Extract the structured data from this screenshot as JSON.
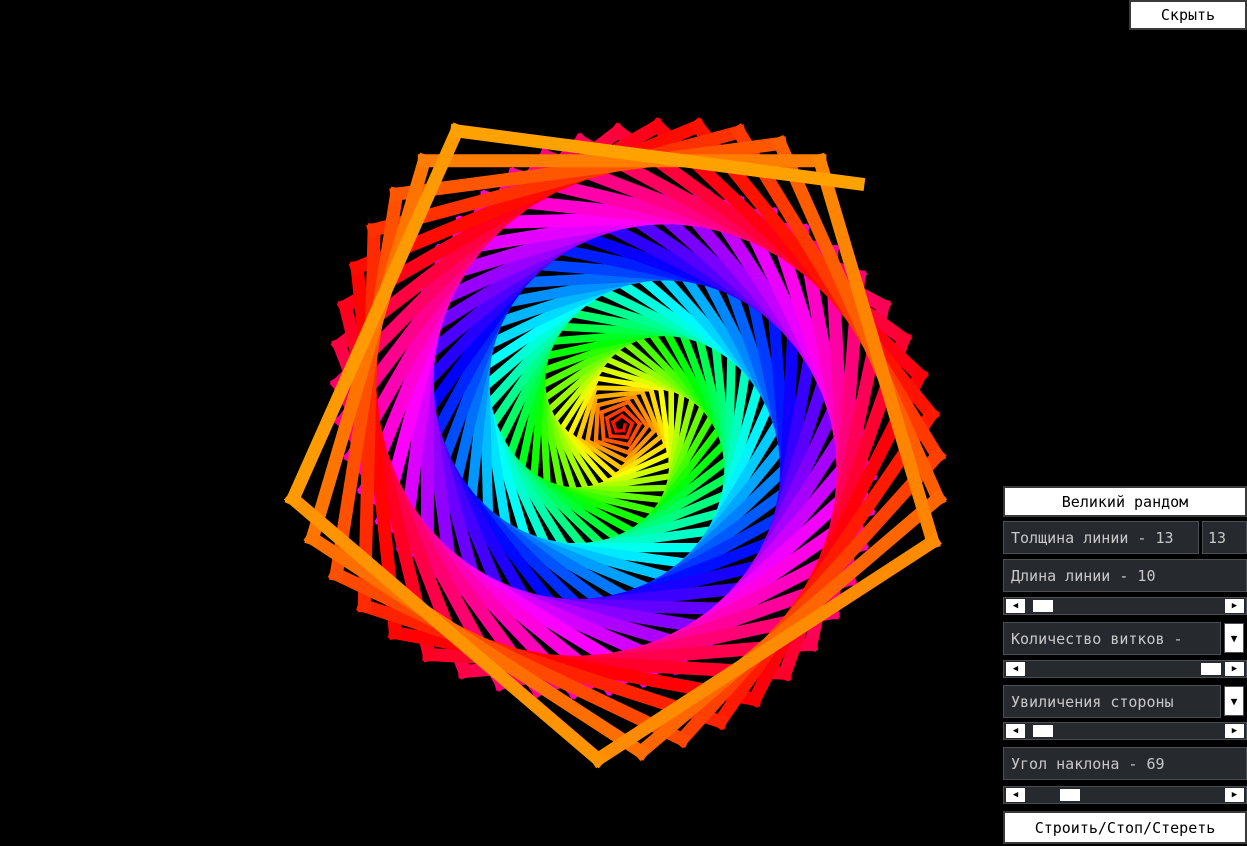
{
  "hide_button": {
    "label": "Скрыть"
  },
  "panel": {
    "random_button": "Великий рандом",
    "line_width": {
      "label": "Толщина линии - 13",
      "value": "13"
    },
    "line_length": {
      "label": "Длина линии - 10",
      "scroll_value": 0.04
    },
    "turns": {
      "label": "Количество витков - ",
      "scroll_value": 0.97
    },
    "side_increase": {
      "label": "Увиличения стороны",
      "scroll_value": 0.04
    },
    "tilt_angle": {
      "label": "Угол наклона - 69",
      "scroll_value": 0.19
    },
    "build_button": "Строить/Стоп/Стереть"
  },
  "arrows": {
    "left": "◀",
    "right": "▶",
    "down": "▼"
  },
  "spiral": {
    "line_width": 13,
    "line_length": 10,
    "tilt_angle": 69,
    "colors": [
      "#ff0033",
      "#ff7700",
      "#ffee00",
      "#66ff00",
      "#00ff66",
      "#00ffee",
      "#0099ff",
      "#2222ff",
      "#8800ff",
      "#ff00ff",
      "#ff0066",
      "#ff4400",
      "#ff8800"
    ]
  }
}
